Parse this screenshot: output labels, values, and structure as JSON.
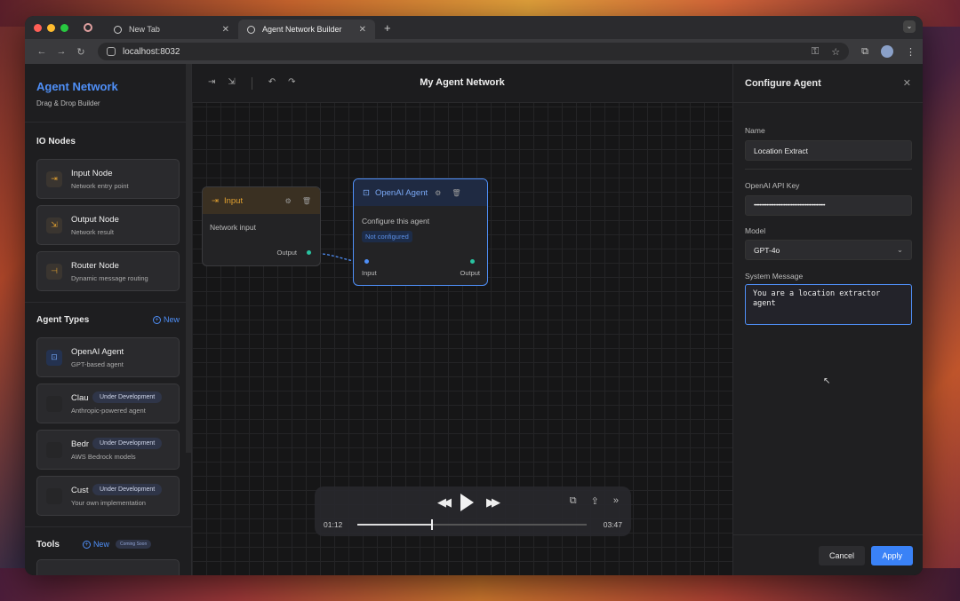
{
  "browser": {
    "tabs": [
      {
        "title": "New Tab"
      },
      {
        "title": "Agent Network Builder"
      }
    ],
    "url": "localhost:8032"
  },
  "sidebar": {
    "app_title": "Agent Network",
    "app_subtitle": "Drag & Drop Builder",
    "io_section": "IO Nodes",
    "io_nodes": [
      {
        "title": "Input Node",
        "desc": "Network entry point"
      },
      {
        "title": "Output Node",
        "desc": "Network result"
      },
      {
        "title": "Router Node",
        "desc": "Dynamic message routing"
      }
    ],
    "agent_section": "Agent Types",
    "new_label": "New",
    "agent_types": [
      {
        "title": "OpenAI Agent",
        "desc": "GPT-based agent"
      },
      {
        "title": "Clau",
        "desc": "Anthropic-powered agent",
        "badge": "Under Development"
      },
      {
        "title": "Bedr",
        "desc": "AWS Bedrock models",
        "badge": "Under Development"
      },
      {
        "title": "Cust",
        "desc": "Your own implementation",
        "badge": "Under Development"
      }
    ],
    "tools_section": "Tools",
    "tools_new_label": "New",
    "tools_badge": "Coming Soon"
  },
  "canvas": {
    "title": "My Agent Network",
    "input_node": {
      "title": "Input",
      "body": "Network input",
      "output_label": "Output"
    },
    "agent_node": {
      "title": "OpenAI Agent",
      "body": "Configure this agent",
      "status": "Not configured",
      "input_label": "Input",
      "output_label": "Output"
    }
  },
  "player": {
    "current_time": "01:12",
    "total_time": "03:47",
    "progress": 0.32
  },
  "config": {
    "title": "Configure Agent",
    "name_label": "Name",
    "name_value": "Location Extract",
    "api_key_label": "OpenAI API Key",
    "api_key_value": "••••••••••••••••••••••••••••••••••••••••••••••••••",
    "model_label": "Model",
    "model_value": "GPT-4o",
    "system_label": "System Message",
    "system_value": "You are a location extractor agent",
    "cancel_label": "Cancel",
    "apply_label": "Apply"
  },
  "colors": {
    "accent": "#4f8ff7",
    "input_node_accent": "#e0a030",
    "port": "#29c2a0"
  }
}
